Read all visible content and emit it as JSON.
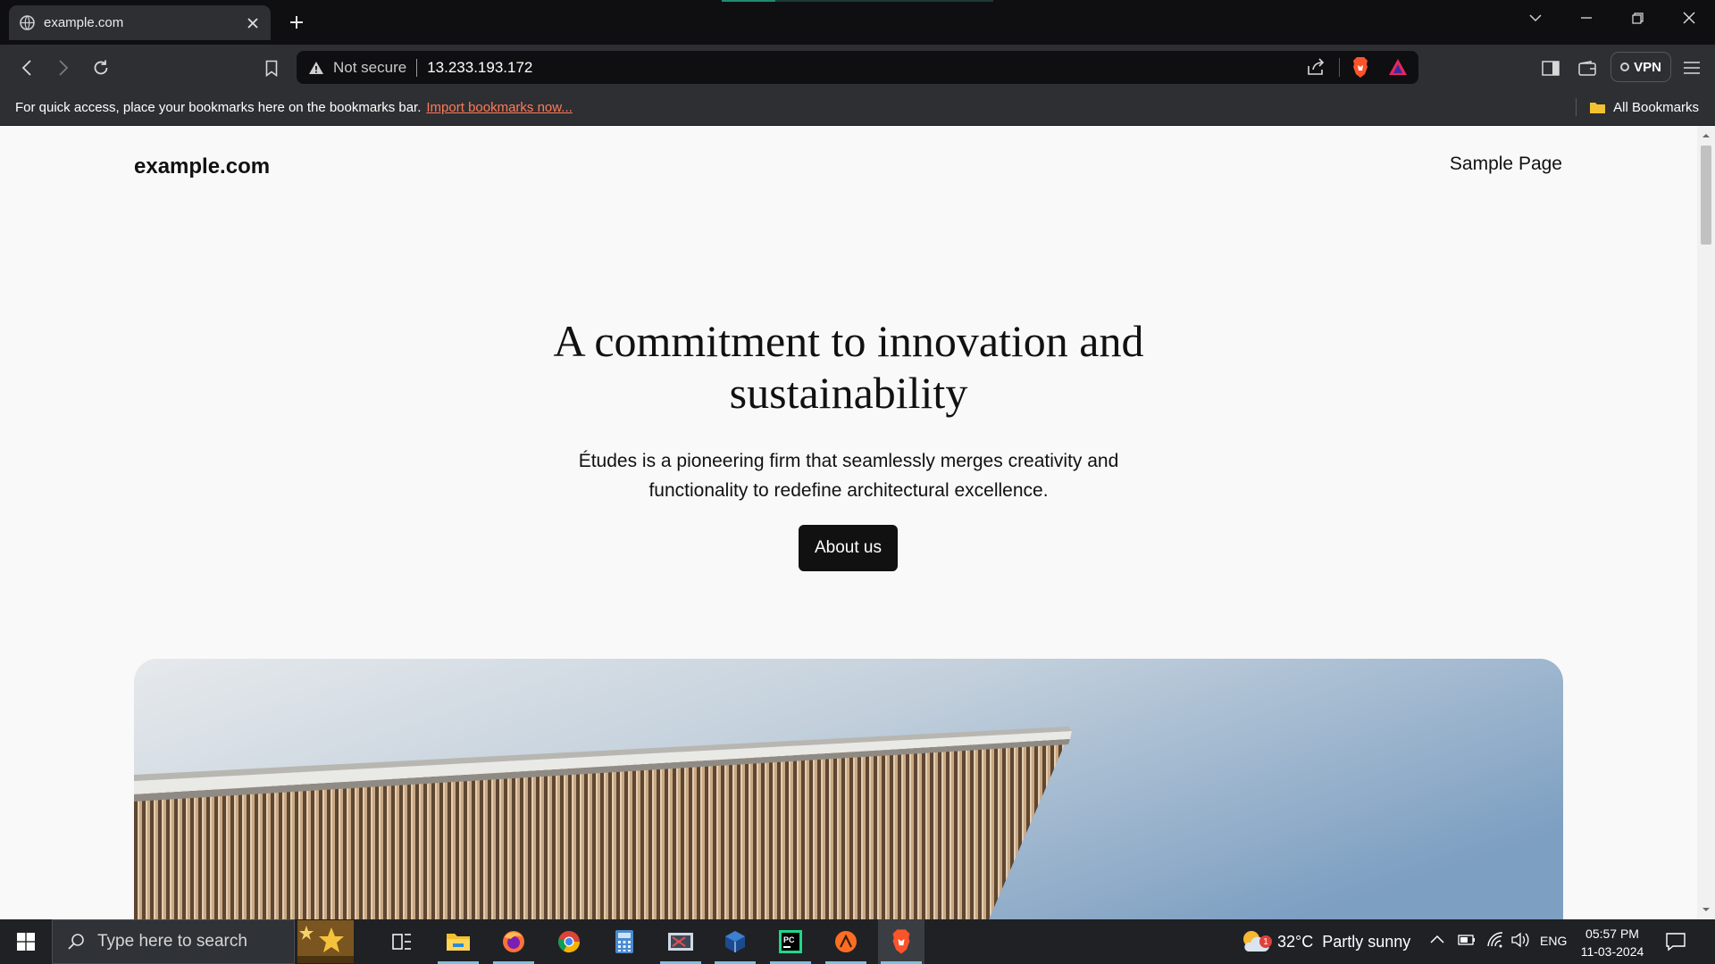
{
  "browser": {
    "tab": {
      "title": "example.com"
    },
    "address": {
      "security": "Not secure",
      "url": "13.233.193.172"
    },
    "vpn_label": "VPN",
    "bookmarks_bar": {
      "hint": "For quick access, place your bookmarks here on the bookmarks bar.",
      "import_link": "Import bookmarks now...",
      "all_bookmarks": "All Bookmarks"
    }
  },
  "page": {
    "site_title": "example.com",
    "nav": [
      "Sample Page"
    ],
    "hero": {
      "title_line1": "A commitment to innovation and",
      "title_line2": "sustainability",
      "text_line1": "Études is a pioneering firm that seamlessly merges creativity and",
      "text_line2": "functionality to redefine architectural excellence.",
      "button": "About us"
    }
  },
  "taskbar": {
    "search_placeholder": "Type here to search",
    "weather": {
      "temp": "32°C",
      "condition": "Partly sunny",
      "badge": "1"
    },
    "language": "ENG",
    "time": "05:57 PM",
    "date": "11-03-2024",
    "apps": [
      "task-view",
      "file-explorer",
      "firefox",
      "chrome",
      "calculator",
      "snipping-tool",
      "virtualbox",
      "pycharm",
      "sublime-merge",
      "brave"
    ]
  }
}
